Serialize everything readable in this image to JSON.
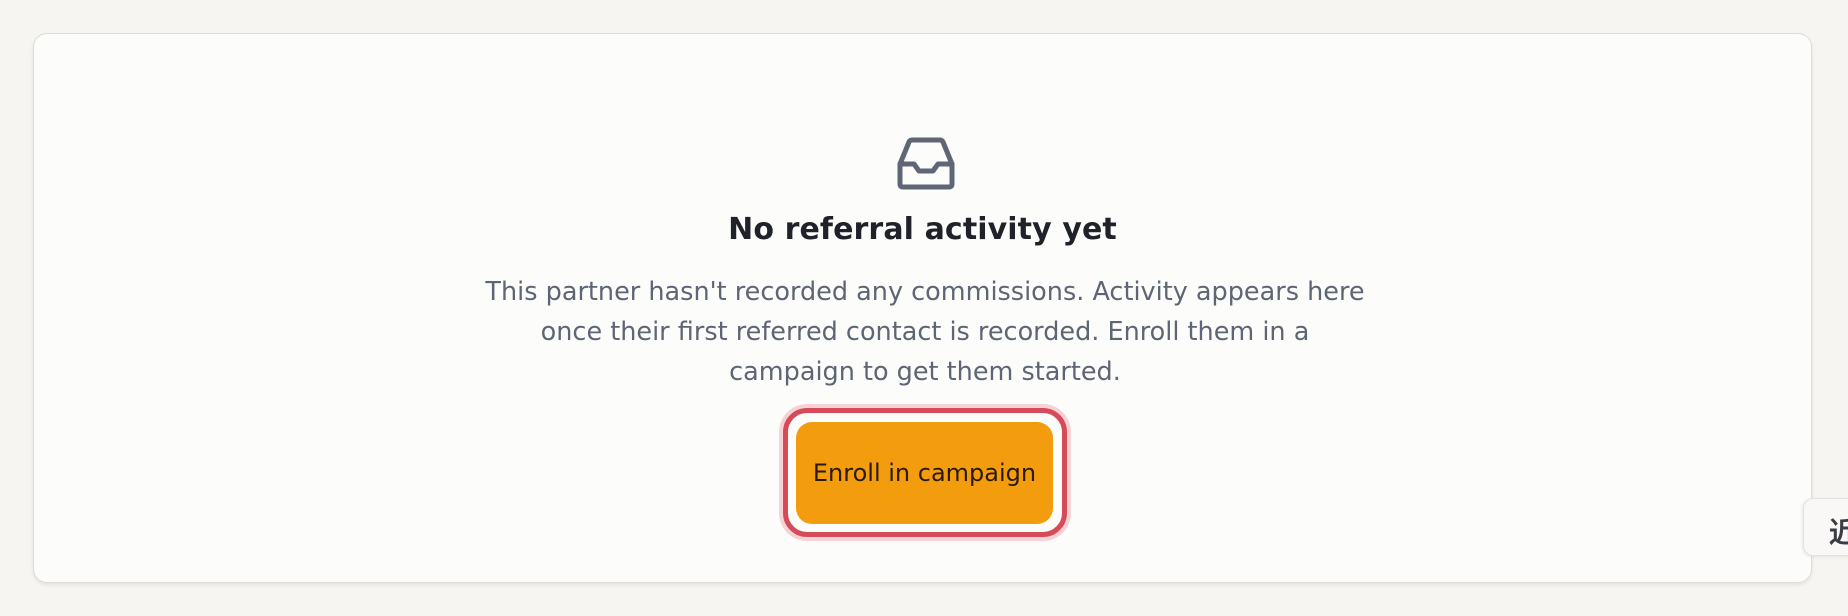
{
  "empty_state": {
    "icon": "inbox-icon",
    "title": "No referral activity yet",
    "description": "This partner hasn't recorded any commissions. Activity appears here once their first referred contact is recorded. Enroll them in a campaign to get them started.",
    "cta_label": "Enroll in campaign"
  },
  "floating_tab": {
    "icon": "feedback-icon",
    "glyph": "近"
  },
  "colors": {
    "page_background": "#f6f5f2",
    "card_background": "#fcfcfa",
    "title": "#1f2329",
    "description": "#5e6574",
    "icon_stroke": "#5f6675",
    "cta_background": "#f39c0d",
    "focus_ring": "#d64b57"
  }
}
